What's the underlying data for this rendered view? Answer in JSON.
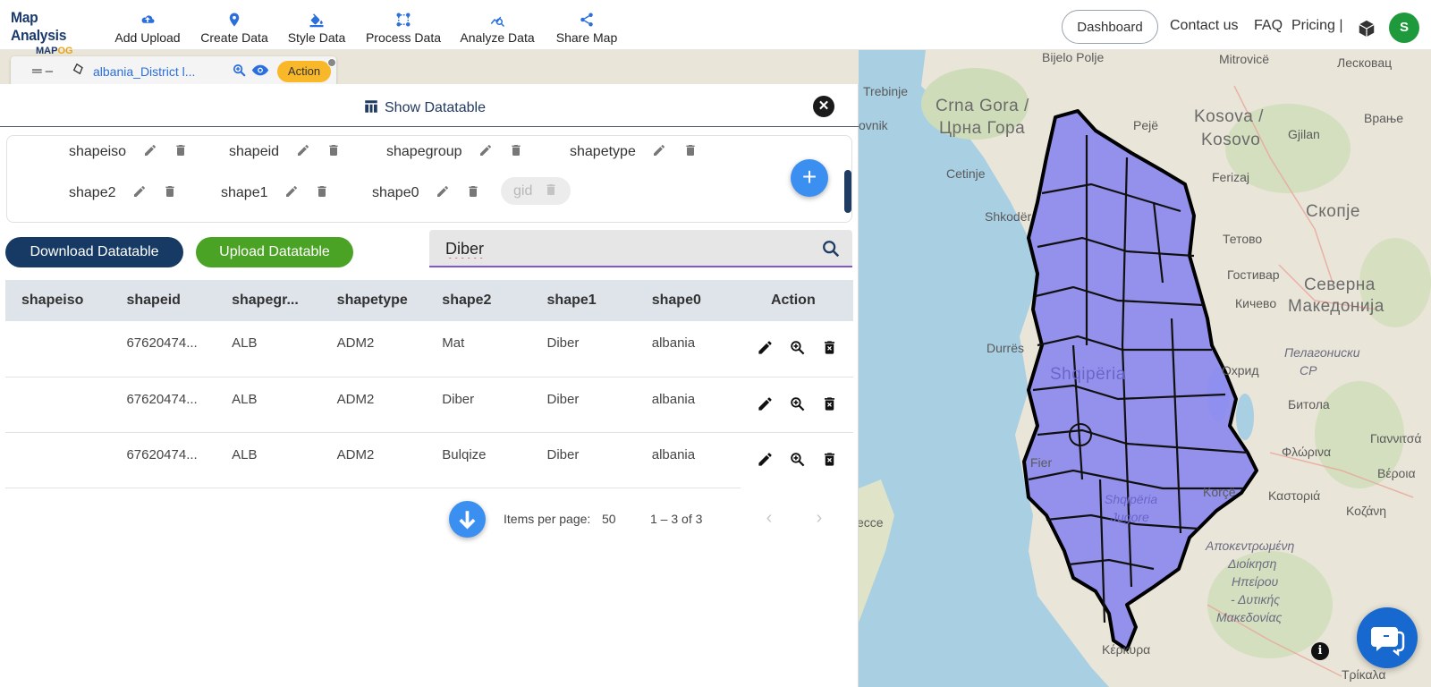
{
  "app": {
    "logo_line1": "Map Analysis",
    "logo_line2_a": "MAP",
    "logo_line2_b": "OG",
    "accent_color": "#2a6fdb"
  },
  "nav": [
    {
      "label": "Add Upload",
      "icon": "cloud-upload-icon"
    },
    {
      "label": "Create Data",
      "icon": "map-pin-icon"
    },
    {
      "label": "Style Data",
      "icon": "paint-bucket-icon"
    },
    {
      "label": "Process Data",
      "icon": "process-nodes-icon"
    },
    {
      "label": "Analyze Data",
      "icon": "analyze-chart-icon"
    },
    {
      "label": "Share Map",
      "icon": "share-icon"
    }
  ],
  "header_right": {
    "dashboard": "Dashboard",
    "contact": "Contact us",
    "faq": "FAQ",
    "pricing": "Pricing |",
    "avatar_initial": "S"
  },
  "layer": {
    "name": "albania_District l...",
    "action_label": "Action"
  },
  "panel": {
    "title": "Show Datatable",
    "columns_row1": [
      "shapeiso",
      "shapeid",
      "shapegroup",
      "shapetype"
    ],
    "columns_row2": [
      "shape2",
      "shape1",
      "shape0"
    ],
    "disabled_column": "gid",
    "download_label": "Download Datatable",
    "upload_label": "Upload Datatable",
    "search_value": "Diber"
  },
  "table": {
    "headers": [
      "shapeiso",
      "shapeid",
      "shapegr...",
      "shapetype",
      "shape2",
      "shape1",
      "shape0",
      "Action"
    ],
    "rows": [
      [
        "",
        "67620474...",
        "ALB",
        "ADM2",
        "Mat",
        "Diber",
        "albania"
      ],
      [
        "",
        "67620474...",
        "ALB",
        "ADM2",
        "Diber",
        "Diber",
        "albania"
      ],
      [
        "",
        "67620474...",
        "ALB",
        "ADM2",
        "Bulqize",
        "Diber",
        "albania"
      ]
    ]
  },
  "pager": {
    "items_label": "Items per page:",
    "items_value": "50",
    "range": "1 – 3 of 3"
  },
  "map_labels": [
    "Bijelo Polje",
    "Mitrovicë",
    "Лесковац",
    "Trebinje",
    "Crna Gora /",
    "Црна Гора",
    "Kosova /",
    "Kosovo",
    "Gjilan",
    "Врање",
    "Pejë",
    "ovnik",
    "Cetinje",
    "Ferizaj",
    "Shkodër",
    "Скопје",
    "Тетово",
    "Гостивар",
    "Северна",
    "Македонија",
    "Кичево",
    "Durrës",
    "Пелагониски",
    "СР",
    "Охрид",
    "Shqipëria",
    "Битола",
    "Fier",
    "Γιαννιτσά",
    "Φλώρινα",
    "Βέροια",
    "Korçë",
    "Καστοριά",
    "Κοζάνη",
    "ecce",
    "Αποκεντρωμένη",
    "Διοίκηση",
    "Ηπείρου",
    "- Δυτικής",
    "Μακεδονίας",
    "Shqipëria",
    "Jugore",
    "Κέρκυρα",
    "Τρίκαλα"
  ],
  "colors": {
    "region_fill": "#8b87f0",
    "sea": "#a9cfe3",
    "land": "#e9e5d8",
    "primary_dark": "#163a63",
    "success": "#4aa325",
    "fab": "#3b8ff0"
  }
}
